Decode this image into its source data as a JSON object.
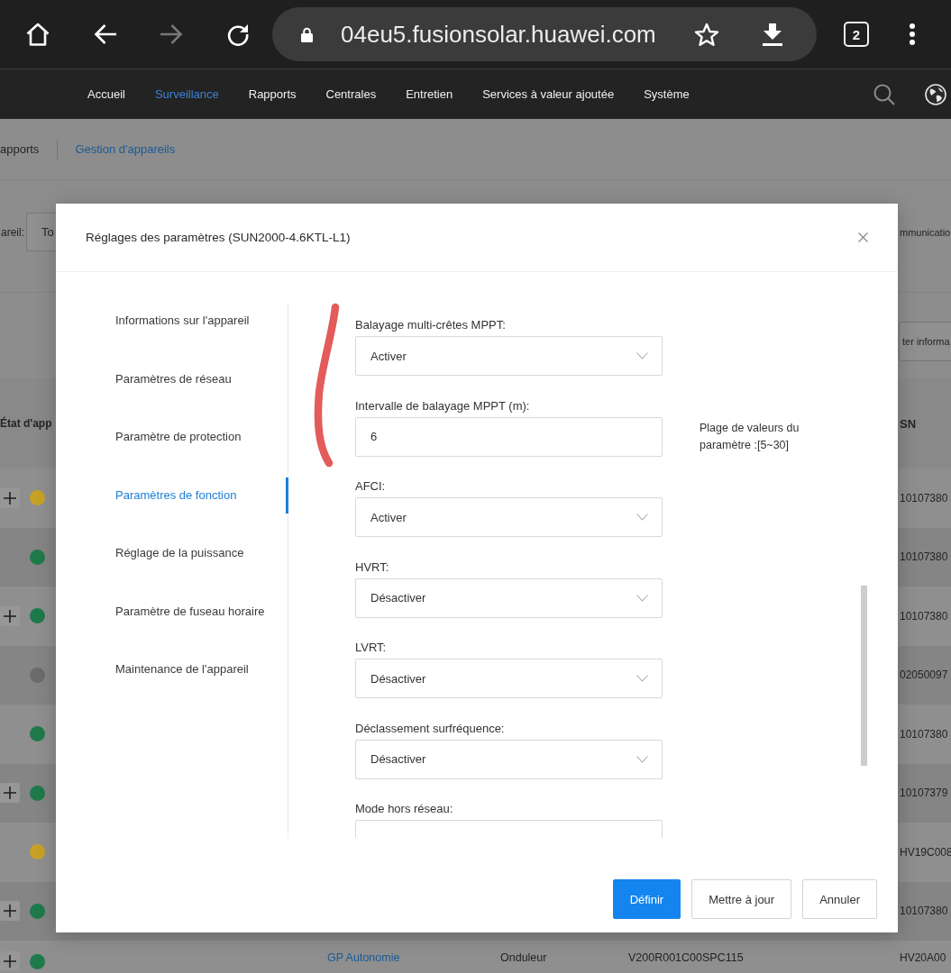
{
  "browser": {
    "url": "04eu5.fusionsolar.huawei.com",
    "tab_count": "2"
  },
  "nav": {
    "items": [
      {
        "label": "Accueil",
        "selected": false
      },
      {
        "label": "Surveillance",
        "selected": true
      },
      {
        "label": "Rapports",
        "selected": false
      },
      {
        "label": "Centrales",
        "selected": false
      },
      {
        "label": "Entretien",
        "selected": false
      },
      {
        "label": "Services à valeur ajoutée",
        "selected": false
      },
      {
        "label": "Système",
        "selected": false
      }
    ]
  },
  "breadcrumb": [
    {
      "label": "apports",
      "selected": false
    },
    {
      "label": "Gestion d'appareils",
      "selected": true
    }
  ],
  "filters": [
    {
      "label": "areil:",
      "value": "To"
    },
    {
      "label": "mmunicatio"
    }
  ],
  "toolbar": {
    "buttons": [
      "ter informa"
    ]
  },
  "table": {
    "columns": [
      "État d'app",
      "SN"
    ],
    "rows": [
      {
        "expandable": true,
        "color": "#c8a126",
        "sn": "10107380"
      },
      {
        "expandable": false,
        "color": "#1f7a4b",
        "sn": "10107380"
      },
      {
        "expandable": true,
        "color": "#1f7a4b",
        "sn": "10107380"
      },
      {
        "expandable": false,
        "color": "#6c6c6c",
        "sn": "02050097"
      },
      {
        "expandable": false,
        "color": "#1f7a4b",
        "sn": "10107380"
      },
      {
        "expandable": true,
        "color": "#1f7a4b",
        "sn": "10107379"
      },
      {
        "expandable": false,
        "color": "#c8a126",
        "sn": "HV19C008"
      },
      {
        "expandable": true,
        "color": "#1f7a4b",
        "sn": "10107380"
      },
      {
        "expandable": true,
        "color": "#1f7a4b",
        "column_3": "GP Autonomie",
        "column_4": "Onduleur",
        "column_5": "V200R001C00SPC115",
        "sn": "HV20A00"
      }
    ]
  },
  "dialog": {
    "title": "Réglages des paramètres (SUN2000-4.6KTL-L1)",
    "sections": [
      {
        "label": "Informations sur l'appareil",
        "selected": false
      },
      {
        "label": "Paramètres de réseau",
        "selected": false
      },
      {
        "label": "Paramètre de protection",
        "selected": false
      },
      {
        "label": "Paramètres de fonction",
        "selected": true
      },
      {
        "label": "Réglage de la puissance",
        "selected": false
      },
      {
        "label": "Paramètre de fuseau horaire",
        "selected": false
      },
      {
        "label": "Maintenance de l'appareil",
        "selected": false
      }
    ],
    "fields": [
      {
        "label": "Balayage multi-crêtes MPPT:",
        "kind": "select",
        "value": "Activer"
      },
      {
        "label": "Intervalle de balayage MPPT (m):",
        "kind": "input",
        "value": "6",
        "hint": "Plage de valeurs du paramètre :[5~30]"
      },
      {
        "label": "AFCI:",
        "kind": "select",
        "value": "Activer"
      },
      {
        "label": "HVRT:",
        "kind": "select",
        "value": "Désactiver"
      },
      {
        "label": "LVRT:",
        "kind": "select",
        "value": "Désactiver"
      },
      {
        "label": "Déclassement surfréquence:",
        "kind": "select",
        "value": "Désactiver"
      },
      {
        "label": "Mode hors réseau:",
        "kind": "select"
      }
    ],
    "buttons": [
      {
        "label": "Définir",
        "kind": "primary"
      },
      {
        "label": "Mettre à jour",
        "kind": "default"
      },
      {
        "label": "Annuler",
        "kind": "default"
      }
    ]
  }
}
